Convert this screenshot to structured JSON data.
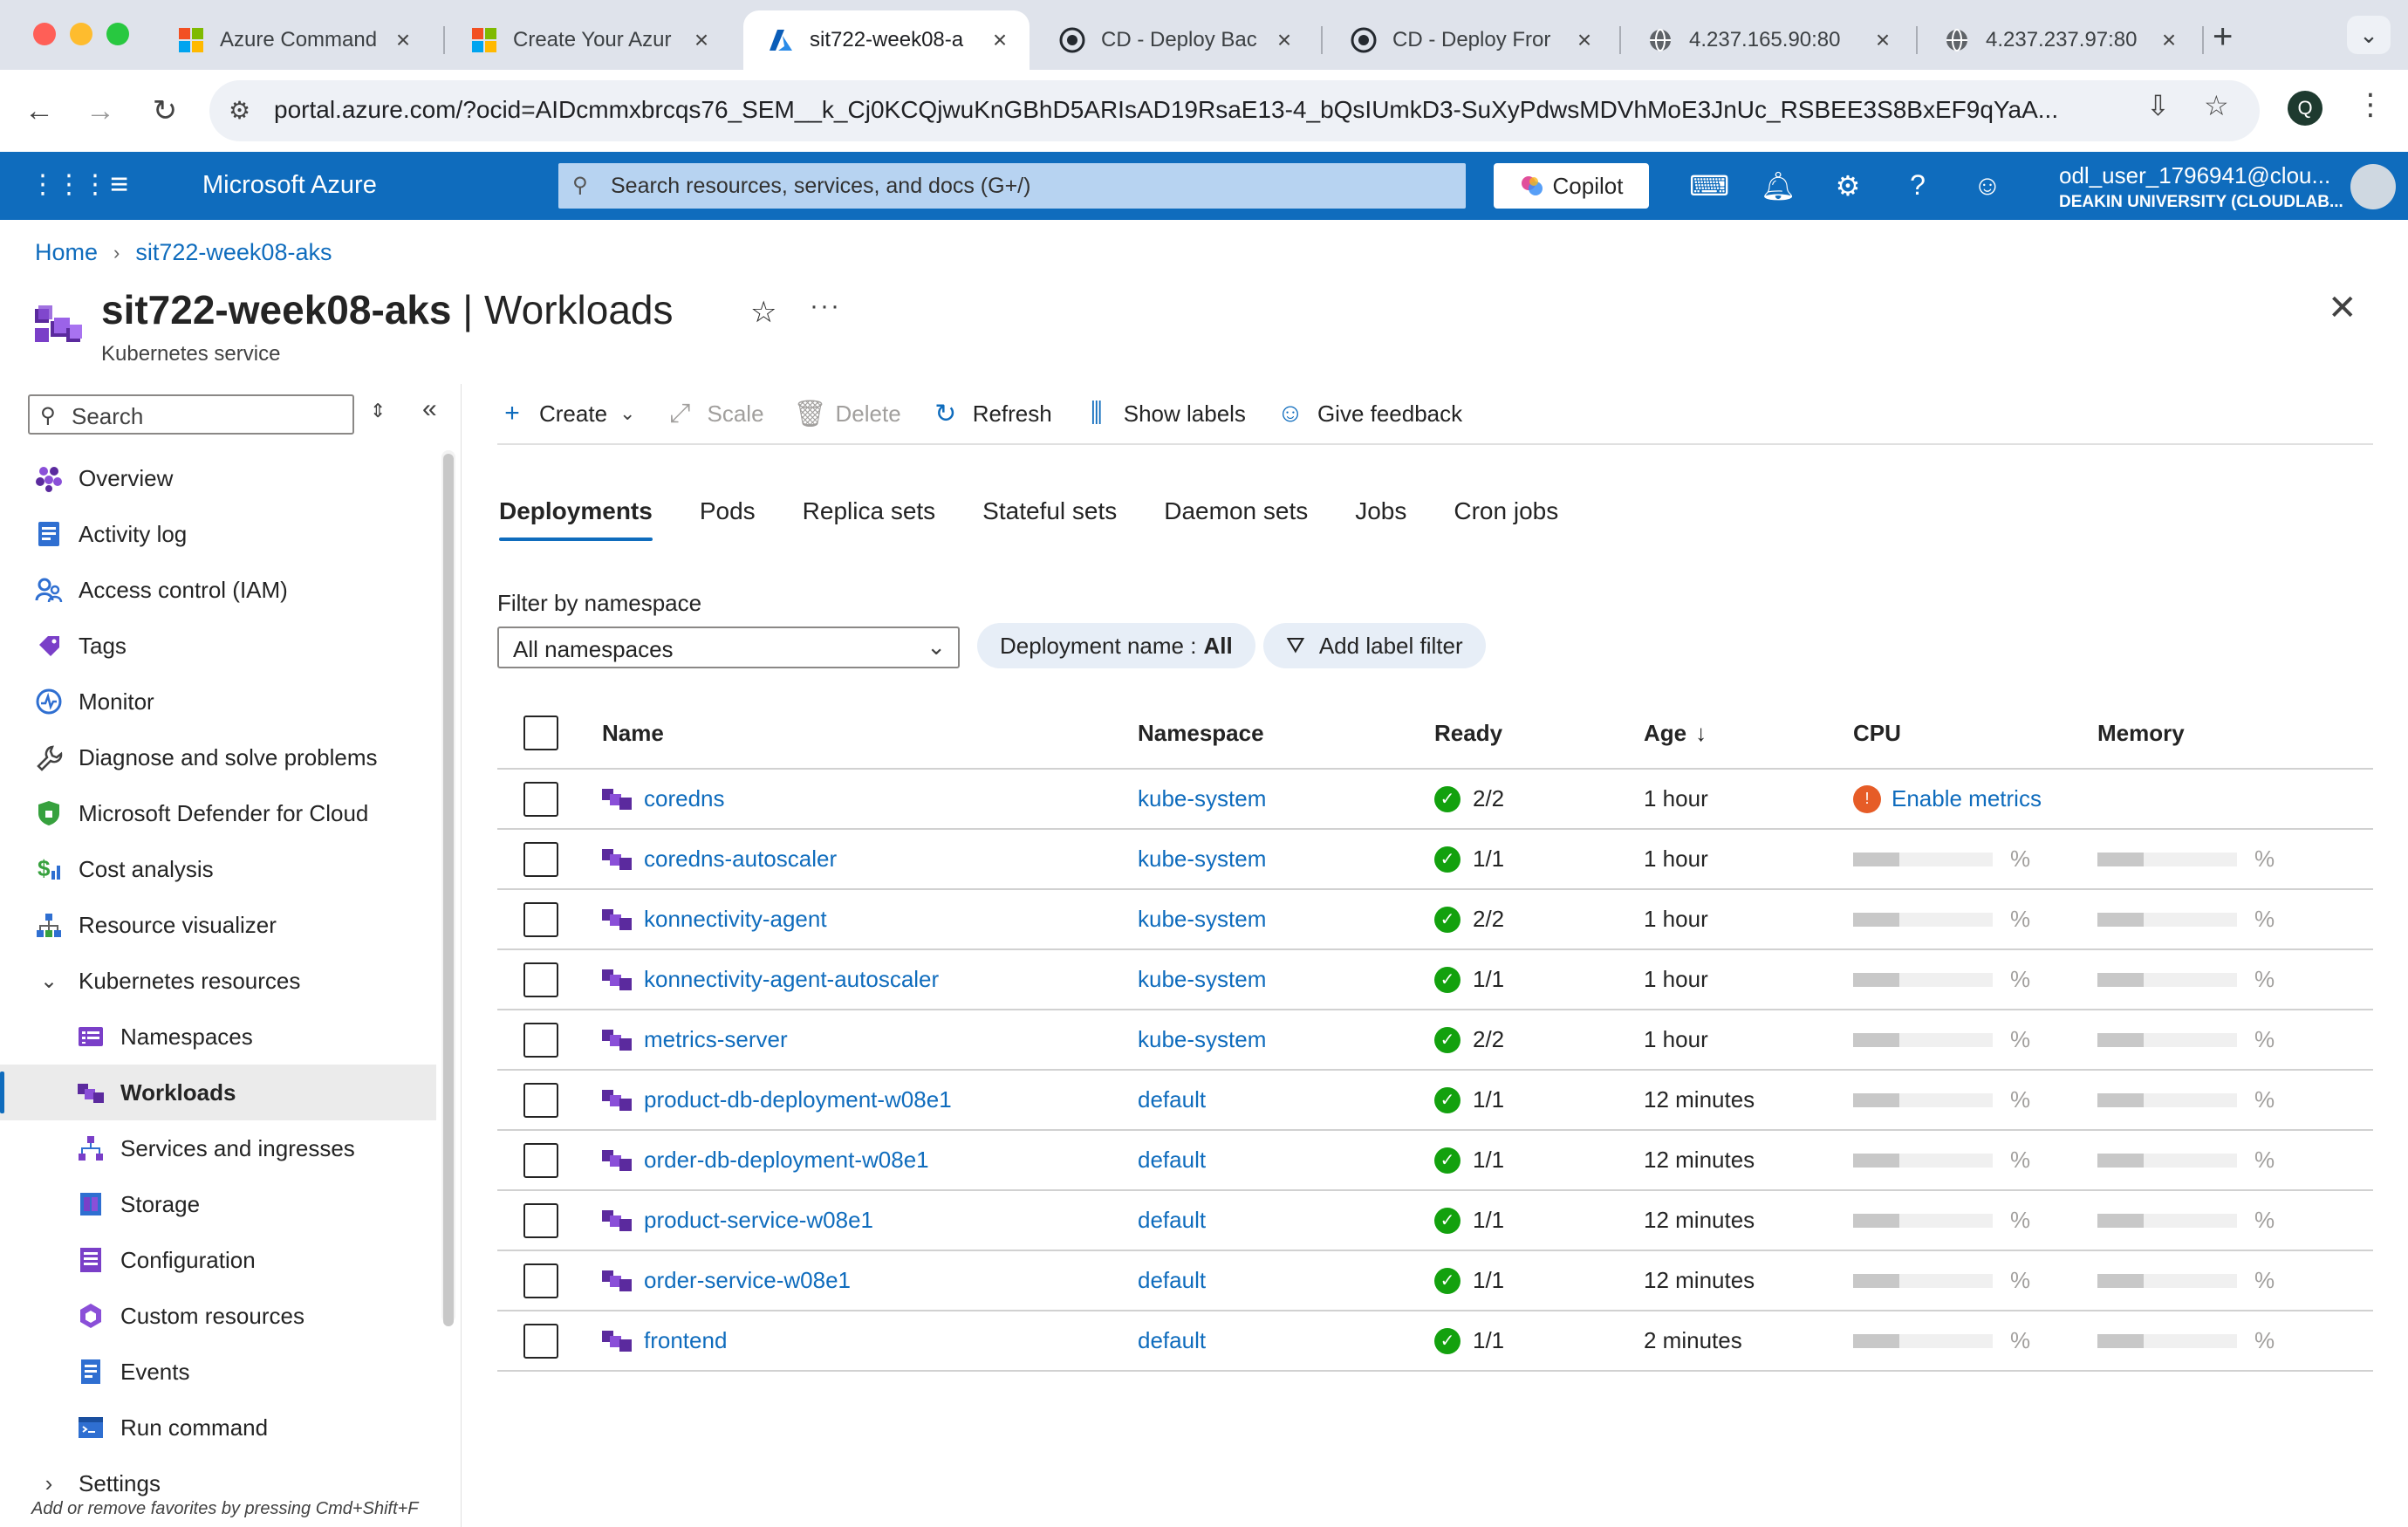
{
  "browser": {
    "tabs": [
      {
        "title": "Azure Command",
        "icon": "microsoft-icon"
      },
      {
        "title": "Create Your Azur",
        "icon": "microsoft-icon"
      },
      {
        "title": "sit722-week08-a",
        "icon": "azure-icon",
        "active": true
      },
      {
        "title": "CD - Deploy Bac",
        "icon": "github-icon"
      },
      {
        "title": "CD - Deploy Fror",
        "icon": "github-icon"
      },
      {
        "title": "4.237.165.90:80",
        "icon": "globe-icon"
      },
      {
        "title": "4.237.237.97:80",
        "icon": "globe-icon"
      }
    ],
    "url": "portal.azure.com/?ocid=AIDcmmxbrcqs76_SEM__k_Cj0KCQjwuKnGBhD5ARIsAD19RsaE13-4_bQsIUmkD3-SuXyPdwsMDVhMoE3JnUc_RSBEE3S8BxEF9qYaA...",
    "profile_initial": "Q"
  },
  "header": {
    "brand": "Microsoft Azure",
    "search_placeholder": "Search resources, services, and docs (G+/)",
    "copilot_label": "Copilot",
    "user_name": "odl_user_1796941@clou...",
    "user_org": "DEAKIN UNIVERSITY (CLOUDLAB..."
  },
  "breadcrumb": {
    "home": "Home",
    "resource": "sit722-week08-aks"
  },
  "page": {
    "resource_name": "sit722-week08-aks",
    "separator": " | ",
    "section": "Workloads",
    "subtitle": "Kubernetes service",
    "more": "···"
  },
  "nav": {
    "search_placeholder": "Search",
    "items": [
      {
        "label": "Overview",
        "icon": "overview-icon",
        "level": 1
      },
      {
        "label": "Activity log",
        "icon": "activity-log-icon",
        "level": 1
      },
      {
        "label": "Access control (IAM)",
        "icon": "iam-icon",
        "level": 1
      },
      {
        "label": "Tags",
        "icon": "tag-icon",
        "level": 1
      },
      {
        "label": "Monitor",
        "icon": "monitor-icon",
        "level": 1
      },
      {
        "label": "Diagnose and solve problems",
        "icon": "wrench-icon",
        "level": 1
      },
      {
        "label": "Microsoft Defender for Cloud",
        "icon": "shield-icon",
        "level": 1
      },
      {
        "label": "Cost analysis",
        "icon": "cost-icon",
        "level": 1
      },
      {
        "label": "Resource visualizer",
        "icon": "visualizer-icon",
        "level": 1
      },
      {
        "label": "Kubernetes resources",
        "icon": "",
        "level": 1,
        "expander": "expanded"
      },
      {
        "label": "Namespaces",
        "icon": "namespaces-icon",
        "level": 2
      },
      {
        "label": "Workloads",
        "icon": "workloads-icon",
        "level": 2,
        "selected": true
      },
      {
        "label": "Services and ingresses",
        "icon": "services-icon",
        "level": 2
      },
      {
        "label": "Storage",
        "icon": "storage-icon",
        "level": 2
      },
      {
        "label": "Configuration",
        "icon": "configuration-icon",
        "level": 2
      },
      {
        "label": "Custom resources",
        "icon": "custom-resources-icon",
        "level": 2
      },
      {
        "label": "Events",
        "icon": "events-icon",
        "level": 2
      },
      {
        "label": "Run command",
        "icon": "run-command-icon",
        "level": 2
      },
      {
        "label": "Settings",
        "icon": "",
        "level": 1,
        "expander": "collapsed"
      }
    ],
    "favorites_hint": "Add or remove favorites by pressing Cmd+Shift+F"
  },
  "commands": [
    {
      "label": "Create",
      "icon": "plus-icon",
      "enabled": true,
      "dropdown": true
    },
    {
      "label": "Scale",
      "icon": "scale-icon",
      "enabled": false
    },
    {
      "label": "Delete",
      "icon": "delete-icon",
      "enabled": false
    },
    {
      "label": "Refresh",
      "icon": "refresh-icon",
      "enabled": true
    },
    {
      "label": "Show labels",
      "icon": "labels-icon",
      "enabled": true
    },
    {
      "label": "Give feedback",
      "icon": "feedback-icon",
      "enabled": true
    }
  ],
  "tabs": [
    "Deployments",
    "Pods",
    "Replica sets",
    "Stateful sets",
    "Daemon sets",
    "Jobs",
    "Cron jobs"
  ],
  "active_tab": "Deployments",
  "filters": {
    "namespace_label": "Filter by namespace",
    "namespace_value": "All namespaces",
    "deployment_pill_prefix": "Deployment name : ",
    "deployment_pill_value": "All",
    "add_label_filter": "Add label filter"
  },
  "table": {
    "columns": {
      "name": "Name",
      "namespace": "Namespace",
      "ready": "Ready",
      "age": "Age",
      "age_sort": "↓",
      "cpu": "CPU",
      "memory": "Memory"
    },
    "enable_metrics": "Enable metrics",
    "rows": [
      {
        "name": "coredns",
        "namespace": "kube-system",
        "ready": "2/2",
        "age": "1 hour",
        "cpu": null,
        "memory": null
      },
      {
        "name": "coredns-autoscaler",
        "namespace": "kube-system",
        "ready": "1/1",
        "age": "1 hour",
        "cpu": "%",
        "memory": "%"
      },
      {
        "name": "konnectivity-agent",
        "namespace": "kube-system",
        "ready": "2/2",
        "age": "1 hour",
        "cpu": "%",
        "memory": "%"
      },
      {
        "name": "konnectivity-agent-autoscaler",
        "namespace": "kube-system",
        "ready": "1/1",
        "age": "1 hour",
        "cpu": "%",
        "memory": "%"
      },
      {
        "name": "metrics-server",
        "namespace": "kube-system",
        "ready": "2/2",
        "age": "1 hour",
        "cpu": "%",
        "memory": "%"
      },
      {
        "name": "product-db-deployment-w08e1",
        "namespace": "default",
        "ready": "1/1",
        "age": "12 minutes",
        "cpu": "%",
        "memory": "%"
      },
      {
        "name": "order-db-deployment-w08e1",
        "namespace": "default",
        "ready": "1/1",
        "age": "12 minutes",
        "cpu": "%",
        "memory": "%"
      },
      {
        "name": "product-service-w08e1",
        "namespace": "default",
        "ready": "1/1",
        "age": "12 minutes",
        "cpu": "%",
        "memory": "%"
      },
      {
        "name": "order-service-w08e1",
        "namespace": "default",
        "ready": "1/1",
        "age": "12 minutes",
        "cpu": "%",
        "memory": "%"
      },
      {
        "name": "frontend",
        "namespace": "default",
        "ready": "1/1",
        "age": "2 minutes",
        "cpu": "%",
        "memory": "%"
      }
    ]
  },
  "colors": {
    "azure_blue": "#0f6cbd",
    "success": "#13a10e",
    "warning": "#e65c27"
  }
}
